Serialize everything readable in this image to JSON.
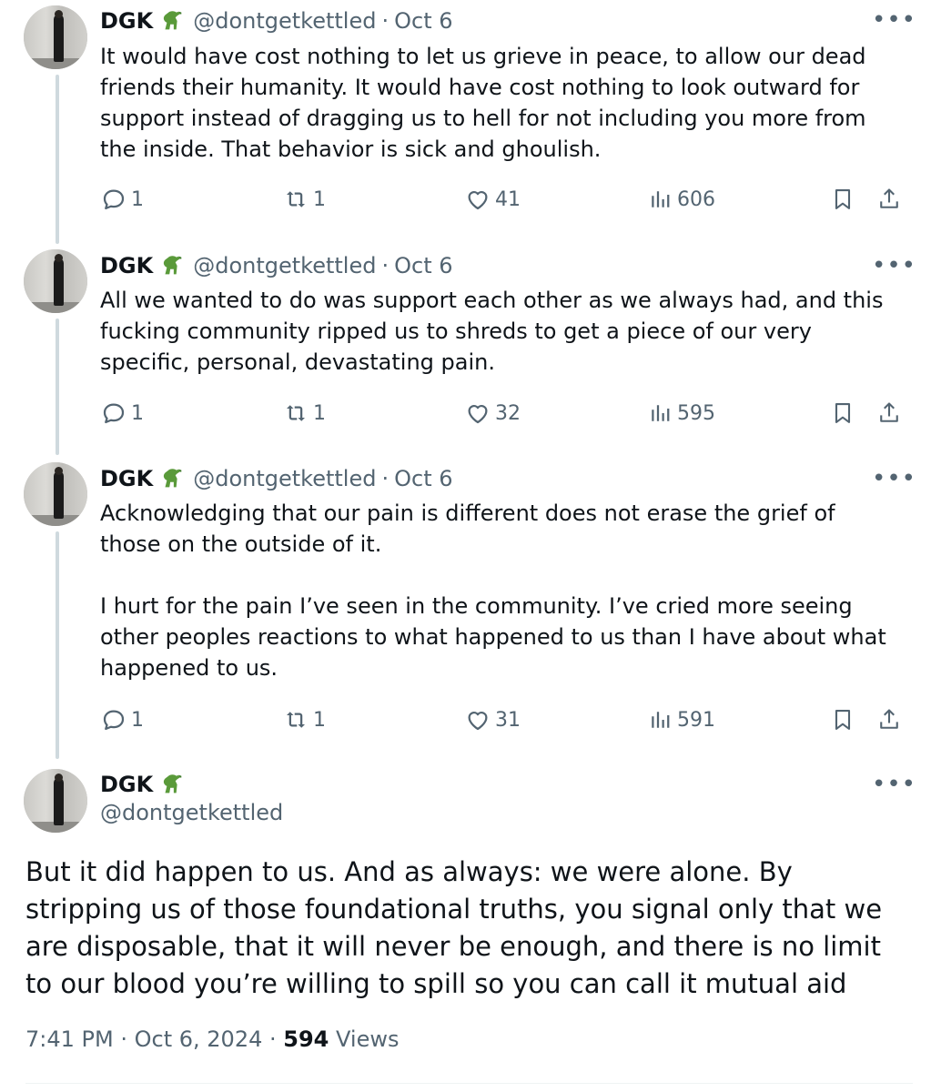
{
  "author": {
    "name": "DGK",
    "handle": "@dontgetkettled",
    "emoji_icon": "t-rex-icon"
  },
  "separator": "·",
  "replies": [
    {
      "date": "Oct 6",
      "text": "It would have cost nothing to let us grieve in peace, to allow our dead friends their humanity. It would have cost nothing to look outward for support instead of dragging us to hell for not including you more from the inside. That behavior is sick and ghoulish.",
      "stats": {
        "replies": "1",
        "reposts": "1",
        "likes": "41",
        "views": "606"
      }
    },
    {
      "date": "Oct 6",
      "text": "All we wanted to do was support each other as we always had, and this fucking community ripped us to shreds to get a piece of our very specific, personal, devastating pain.",
      "stats": {
        "replies": "1",
        "reposts": "1",
        "likes": "32",
        "views": "595"
      }
    },
    {
      "date": "Oct 6",
      "text": "Acknowledging that our pain is different does not erase the grief of those on the outside of it.\n\nI hurt for the pain I’ve seen in the community. I’ve cried more seeing other peoples reactions to what happened to us than I have about what happened to us.",
      "stats": {
        "replies": "1",
        "reposts": "1",
        "likes": "31",
        "views": "591"
      }
    }
  ],
  "main_tweet": {
    "text": "But it did happen to us. And as always: we were alone. By stripping us of those foundational truths, you signal only that we are disposable, that it will never be enough, and there is no limit to our blood you’re willing to spill so you can call it mutual aid",
    "time": "7:41 PM",
    "date": "Oct 6, 2024",
    "views_count": "594",
    "views_label": "Views"
  },
  "colors": {
    "text": "#0f1419",
    "secondary": "#536471",
    "thread_line": "#cfd9de",
    "background": "#ffffff"
  }
}
